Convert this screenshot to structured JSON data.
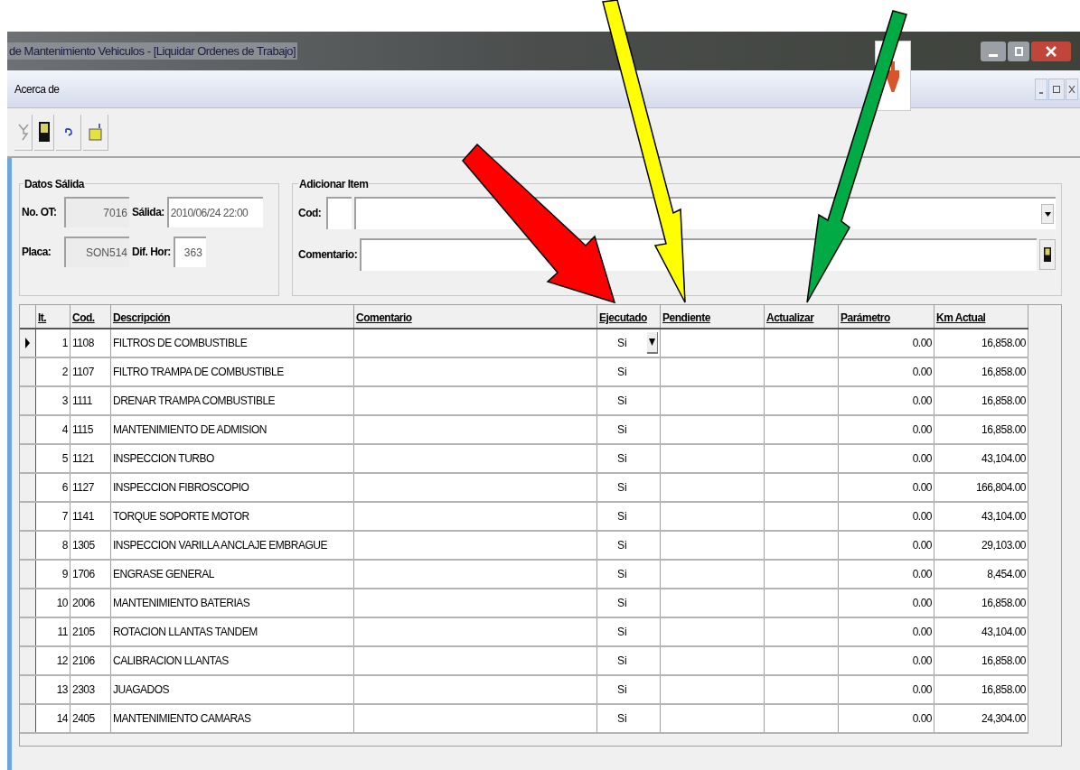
{
  "window": {
    "title": "de Mantenimiento Vehiculos - [Liquidar Ordenes de Trabajo]"
  },
  "menu": [
    "Acerca de"
  ],
  "datos_salida": {
    "title": "Datos Sálida",
    "no_ot": {
      "label": "No. OT:",
      "value": "7016"
    },
    "salida": {
      "label": "Sálida:",
      "value": "2010/06/24 22:00"
    },
    "placa": {
      "label": "Placa:",
      "value": "SON514"
    },
    "dif_hor": {
      "label": "Dif. Hor:",
      "value": "363"
    }
  },
  "adicionar_item": {
    "title": "Adicionar Item",
    "cod_label": "Cod:",
    "comentario_label": "Comentario:"
  },
  "table": {
    "columns": [
      "It.",
      "Cod.",
      "Descripción",
      "Comentario",
      "Ejecutado",
      "Pendiente",
      "Actualizar",
      "Parámetro",
      "Km Actual"
    ],
    "rows": [
      {
        "it": "1",
        "cod": "1108",
        "descripcion": "FILTROS DE COMBUSTIBLE",
        "ejecutado": "Si",
        "parametro": "0.00",
        "km": "16,858.00",
        "selected": true
      },
      {
        "it": "2",
        "cod": "1107",
        "descripcion": "FILTRO TRAMPA DE COMBUSTIBLE",
        "ejecutado": "Si",
        "parametro": "0.00",
        "km": "16,858.00",
        "selected": false
      },
      {
        "it": "3",
        "cod": "1111",
        "descripcion": "DRENAR TRAMPA COMBUSTIBLE",
        "ejecutado": "Si",
        "parametro": "0.00",
        "km": "16,858.00",
        "selected": false
      },
      {
        "it": "4",
        "cod": "1115",
        "descripcion": "MANTENIMIENTO DE ADMISION",
        "ejecutado": "Si",
        "parametro": "0.00",
        "km": "16,858.00",
        "selected": false
      },
      {
        "it": "5",
        "cod": "1121",
        "descripcion": "INSPECCION TURBO",
        "ejecutado": "Si",
        "parametro": "0.00",
        "km": "43,104.00",
        "selected": false
      },
      {
        "it": "6",
        "cod": "1127",
        "descripcion": "INSPECCION FIBROSCOPIO",
        "ejecutado": "Si",
        "parametro": "0.00",
        "km": "166,804.00",
        "selected": false
      },
      {
        "it": "7",
        "cod": "1141",
        "descripcion": "TORQUE SOPORTE MOTOR",
        "ejecutado": "Si",
        "parametro": "0.00",
        "km": "43,104.00",
        "selected": false
      },
      {
        "it": "8",
        "cod": "1305",
        "descripcion": "INSPECCION VARILLA ANCLAJE EMBRAGUE",
        "ejecutado": "Si",
        "parametro": "0.00",
        "km": "29,103.00",
        "selected": false
      },
      {
        "it": "9",
        "cod": "1706",
        "descripcion": "ENGRASE GENERAL",
        "ejecutado": "Si",
        "parametro": "0.00",
        "km": "8,454.00",
        "selected": false
      },
      {
        "it": "10",
        "cod": "2006",
        "descripcion": "MANTENIMIENTO BATERIAS",
        "ejecutado": "Si",
        "parametro": "0.00",
        "km": "16,858.00",
        "selected": false
      },
      {
        "it": "11",
        "cod": "2105",
        "descripcion": "ROTACION LLANTAS TANDEM",
        "ejecutado": "Si",
        "parametro": "0.00",
        "km": "43,104.00",
        "selected": false
      },
      {
        "it": "12",
        "cod": "2106",
        "descripcion": "CALIBRACION LLANTAS",
        "ejecutado": "Si",
        "parametro": "0.00",
        "km": "16,858.00",
        "selected": false
      },
      {
        "it": "13",
        "cod": "2303",
        "descripcion": "JUAGADOS",
        "ejecutado": "Si",
        "parametro": "0.00",
        "km": "16,858.00",
        "selected": false
      },
      {
        "it": "14",
        "cod": "2405",
        "descripcion": "MANTENIMIENTO CAMARAS",
        "ejecutado": "Si",
        "parametro": "0.00",
        "km": "24,304.00",
        "selected": false
      }
    ]
  }
}
